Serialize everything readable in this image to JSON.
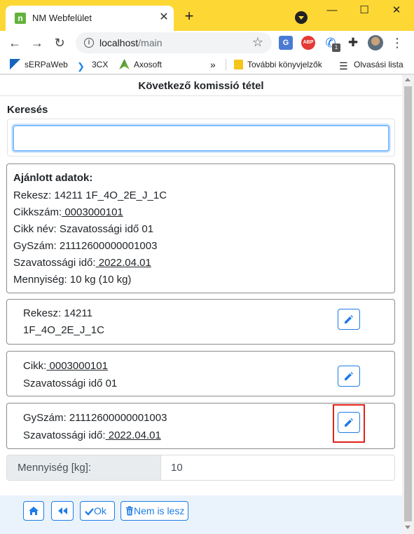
{
  "browser": {
    "tab_title": "NM Webfelület",
    "tab_favicon_text": "n",
    "url_host": "localhost",
    "url_path": "/main",
    "bookmarks": [
      {
        "label": "sERPaWeb",
        "icon": "serpaweb-icon",
        "color": "#1565c0"
      },
      {
        "label": "3CX",
        "icon": "3cx-icon",
        "color": "#1e88e5"
      },
      {
        "label": "Axosoft",
        "icon": "axosoft-icon",
        "color": "#43a047"
      }
    ],
    "bookmarks_more": "»",
    "bookmarks_folder": "További könyvjelzők",
    "reading_list": "Olvasási lista",
    "ext_badge": "1",
    "accent_color": "#fdd835"
  },
  "page": {
    "title": "Következő komissió tétel",
    "search": {
      "label": "Keresés",
      "value": "",
      "placeholder": ""
    },
    "suggested": {
      "heading": "Ajánlott adatok:",
      "rekesz": "Rekesz: 14211 1F_4O_2E_J_1C",
      "cikkszam_label": "Cikkszám:",
      "cikkszam_value": " 0003000101",
      "cikk_nev": "Cikk név: Szavatossági idő 01",
      "gyszam": "GySzám: 21112600000001003",
      "szavatossag_label": "Szavatossági idő:",
      "szavatossag_value": " 2022.04.01",
      "mennyiseg": "Mennyiség: 10 kg (10 kg)"
    },
    "items": {
      "rekesz": {
        "line1": "Rekesz: 14211",
        "line2": "1F_4O_2E_J_1C"
      },
      "cikk": {
        "line1_label": "Cikk:",
        "line1_value": " 0003000101",
        "line2": "Szavatossági idő 01"
      },
      "gyszam": {
        "line1": "GySzám: 21112600000001003",
        "line2_label": "Szavatossági idő:",
        "line2_value": " 2022.04.01"
      }
    },
    "quantity": {
      "label": "Mennyiség [kg]:",
      "value": "10"
    }
  },
  "footer": {
    "home_icon": "home-icon",
    "back_icon": "rewind-icon",
    "ok_label": "Ok",
    "cancel_label": "Nem is lesz",
    "button_color": "#1e7ce6"
  }
}
